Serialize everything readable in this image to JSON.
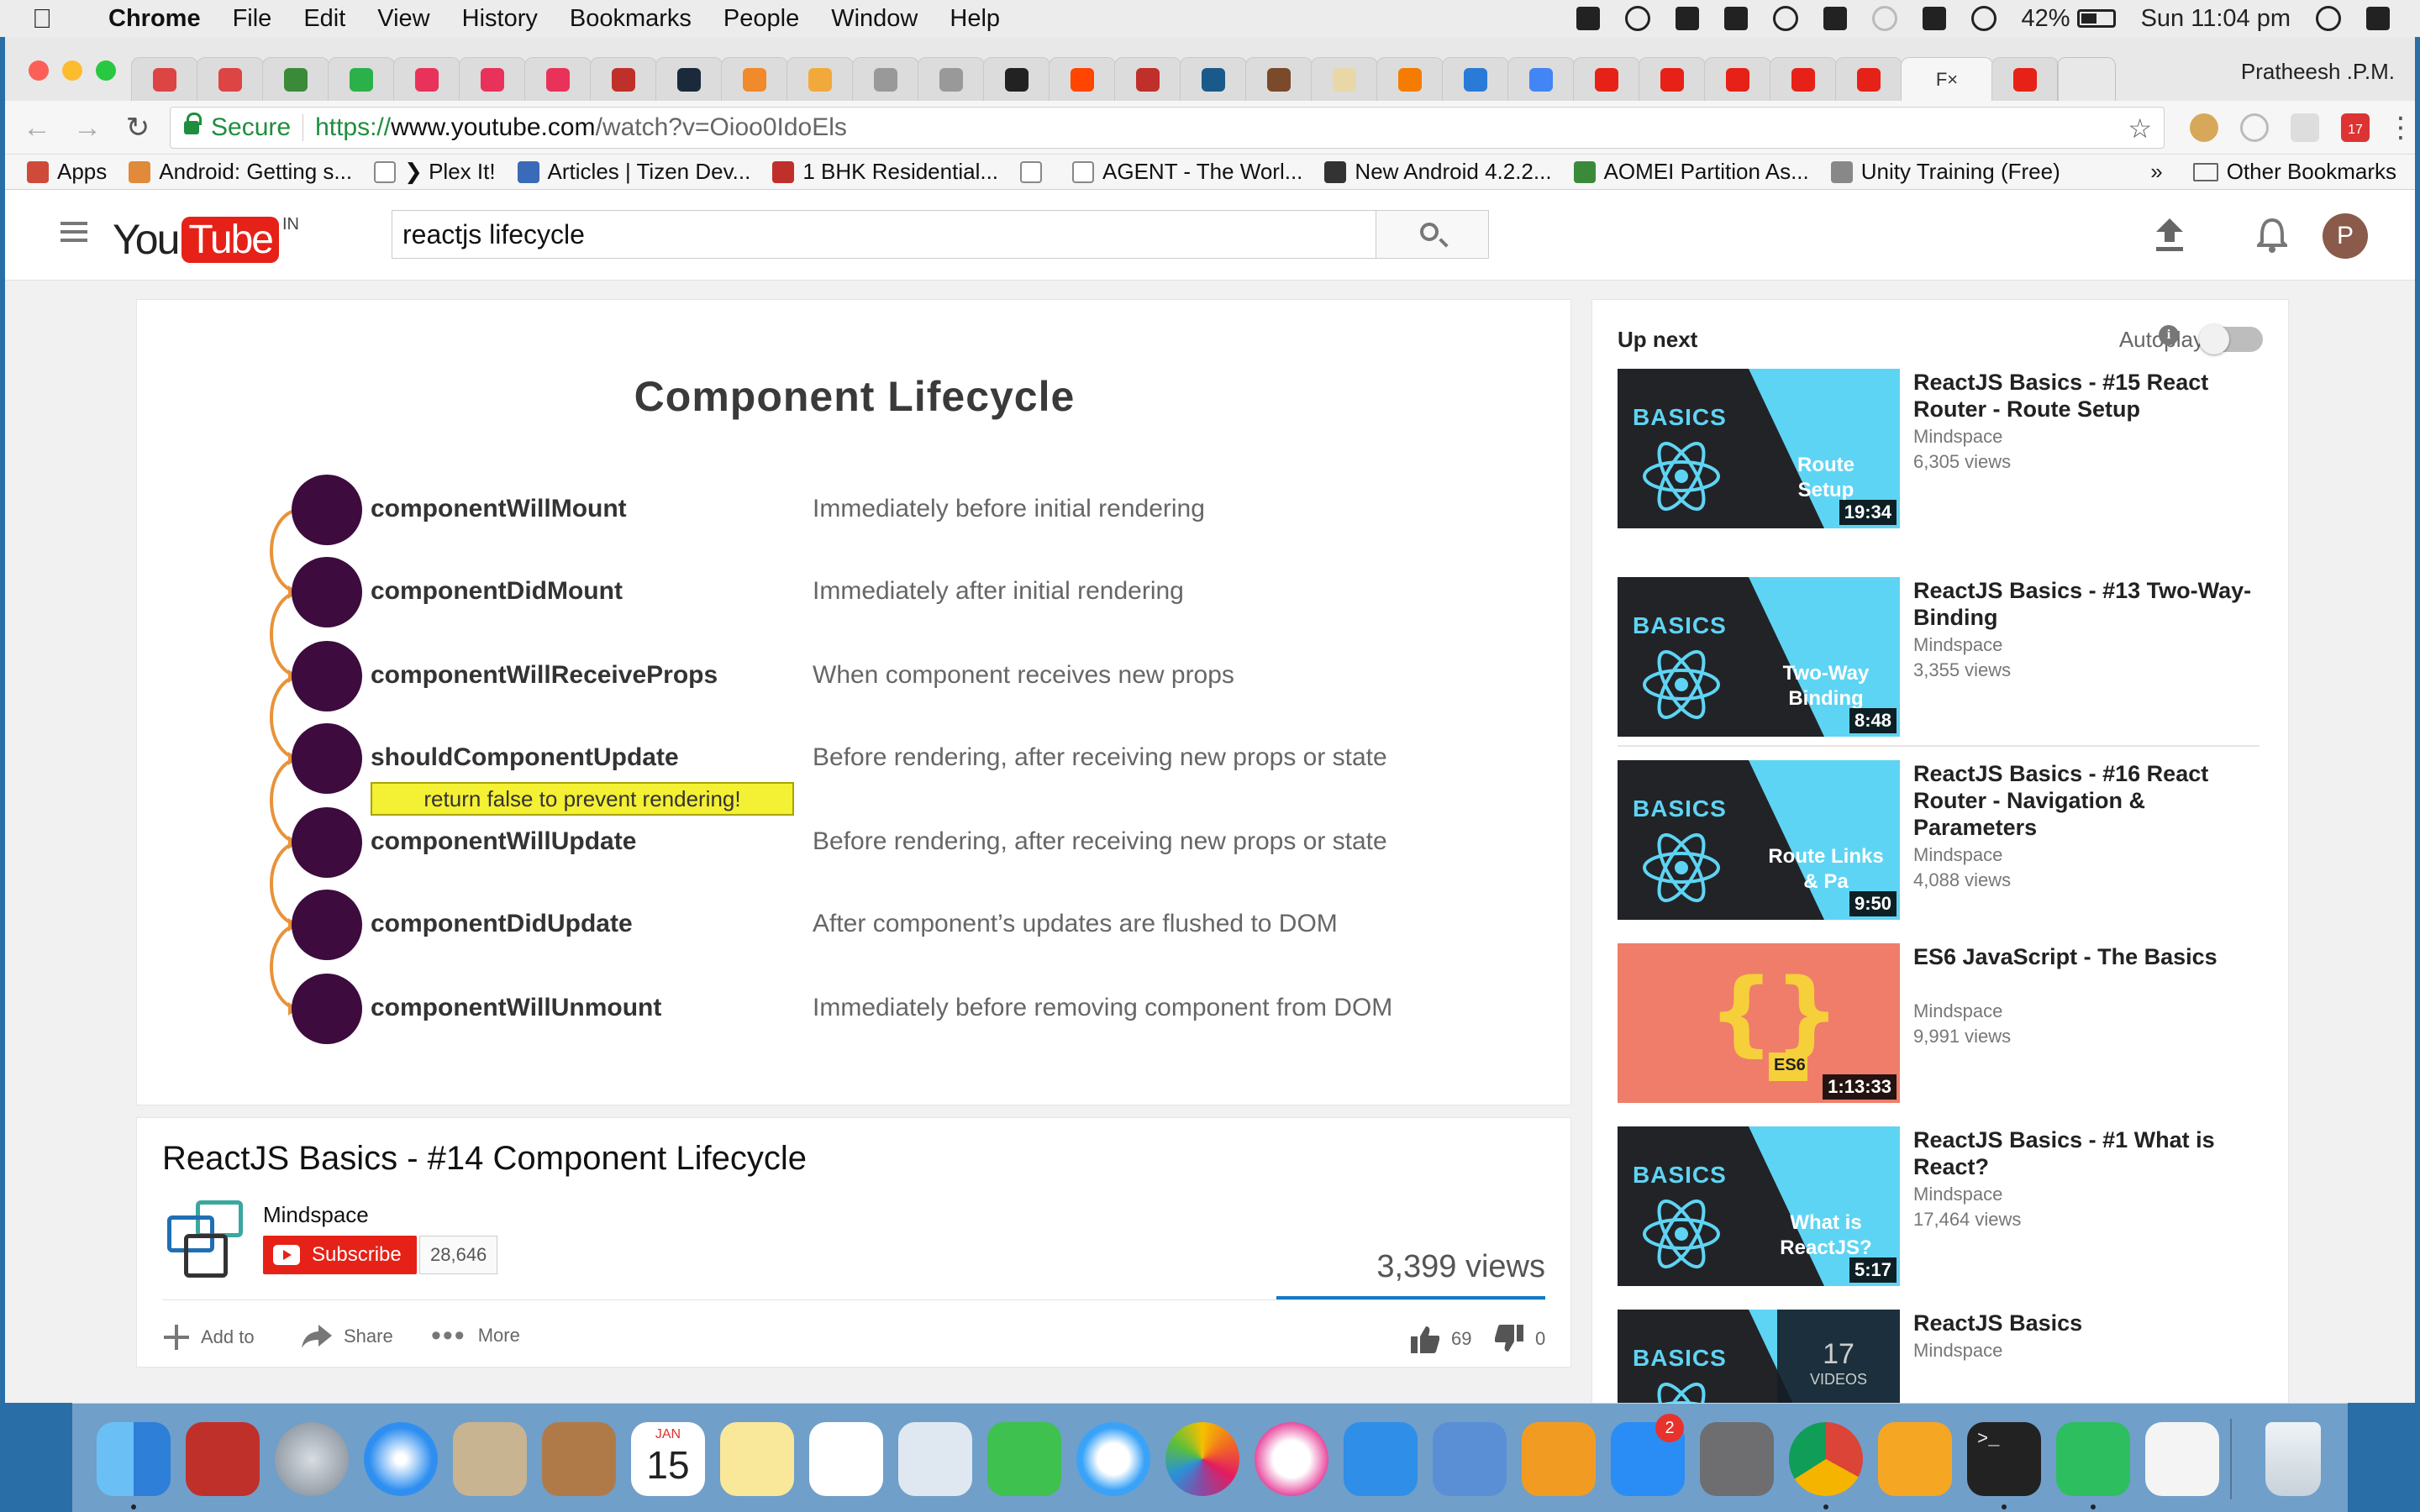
{
  "menubar": {
    "app": "Chrome",
    "menus": [
      "File",
      "Edit",
      "View",
      "History",
      "Bookmarks",
      "People",
      "Window",
      "Help"
    ],
    "battery": "42%",
    "clock": "Sun 11:04 pm"
  },
  "browser": {
    "profile_name": "Pratheesh .P.M.",
    "active_tab_label": "F",
    "secure_label": "Secure",
    "url_proto": "https://",
    "url_host": "www.youtube.com",
    "url_path": "/watch?v=Oioo0IdoEls",
    "bookmarks": [
      {
        "label": "Apps",
        "color": "#d04a3a"
      },
      {
        "label": "Android: Getting s...",
        "color": "#e08a3a"
      },
      {
        "label": "❯ Plex It!",
        "color": "#ffffff"
      },
      {
        "label": "Articles | Tizen Dev...",
        "color": "#3a6ab8"
      },
      {
        "label": "1 BHK Residential...",
        "color": "#c0302a"
      },
      {
        "label": "",
        "color": "#ffffff"
      },
      {
        "label": "AGENT - The Worl...",
        "color": "#ffffff"
      },
      {
        "label": "New Android 4.2.2...",
        "color": "#333333"
      },
      {
        "label": "AOMEI Partition As...",
        "color": "#3a8a3a"
      },
      {
        "label": "Unity Training (Free)",
        "color": "#888888"
      }
    ],
    "other_bookmarks": "Other Bookmarks",
    "overflow": "»",
    "calendar_day": "17"
  },
  "youtube": {
    "logo_you": "You",
    "logo_tube": "Tube",
    "logo_region": "IN",
    "search_query": "reactjs lifecycle",
    "avatar_letter": "P",
    "slide": {
      "title": "Component Lifecycle",
      "note": "return false to prevent rendering!",
      "rows": [
        {
          "method": "componentWillMount",
          "desc": "Immediately before initial rendering"
        },
        {
          "method": "componentDidMount",
          "desc": "Immediately after initial rendering"
        },
        {
          "method": "componentWillReceiveProps",
          "desc": "When component receives new props"
        },
        {
          "method": "shouldComponentUpdate",
          "desc": "Before rendering, after receiving new props or state"
        },
        {
          "method": "componentWillUpdate",
          "desc": "Before rendering, after receiving new props or state"
        },
        {
          "method": "componentDidUpdate",
          "desc": "After component’s updates are flushed to DOM"
        },
        {
          "method": "componentWillUnmount",
          "desc": "Immediately before removing component from DOM"
        }
      ]
    },
    "video": {
      "title": "ReactJS Basics - #14 Component Lifecycle",
      "channel": "Mindspace",
      "subscribe": "Subscribe",
      "subscribers": "28,646",
      "views": "3,399 views",
      "add_to": "Add to",
      "share": "Share",
      "more": "More",
      "likes": "69",
      "dislikes": "0"
    },
    "sidebar": {
      "up_next": "Up next",
      "autoplay": "Autoplay",
      "autoplay_on": false,
      "items": [
        {
          "title": "ReactJS Basics - #15 React Router - Route Setup",
          "channel": "Mindspace",
          "views": "6,305 views",
          "duration": "19:34",
          "thumb_label": "BASICS",
          "thumb_sub": "Route Setup",
          "style": "basics"
        },
        {
          "title": "ReactJS Basics - #13 Two-Way-Binding",
          "channel": "Mindspace",
          "views": "3,355 views",
          "duration": "8:48",
          "thumb_label": "BASICS",
          "thumb_sub": "Two-Way Binding",
          "style": "basics"
        },
        {
          "title": "ReactJS Basics - #16 React Router - Navigation & Parameters",
          "channel": "Mindspace",
          "views": "4,088 views",
          "duration": "9:50",
          "thumb_label": "BASICS",
          "thumb_sub": "Route Links & Pa",
          "style": "basics"
        },
        {
          "title": "ES6 JavaScript - The Basics",
          "channel": "Mindspace",
          "views": "9,991 views",
          "duration": "1:13:33",
          "thumb_label": "ES6",
          "thumb_sub": "",
          "style": "es6"
        },
        {
          "title": "ReactJS Basics - #1 What is React?",
          "channel": "Mindspace",
          "views": "17,464 views",
          "duration": "5:17",
          "thumb_label": "BASICS",
          "thumb_sub": "What is ReactJS?",
          "style": "basics"
        },
        {
          "title": "ReactJS Basics",
          "channel": "Mindspace",
          "views": "",
          "duration": "",
          "thumb_label": "BASICS",
          "thumb_sub": "",
          "playlist_count": "17",
          "playlist_label": "VIDEOS",
          "style": "playlist"
        }
      ]
    }
  },
  "dock": {
    "calendar_month": "JAN",
    "calendar_day": "15",
    "appstore_badge": "2",
    "terminal_prompt": ">_"
  },
  "colors": {
    "youtube_red": "#e62117",
    "lifecycle_dot": "#3d0b3e",
    "arc": "#e8933a",
    "react_cyan": "#5ed4f4",
    "note_yellow": "#f4f033",
    "link_blue": "#167ac6"
  }
}
